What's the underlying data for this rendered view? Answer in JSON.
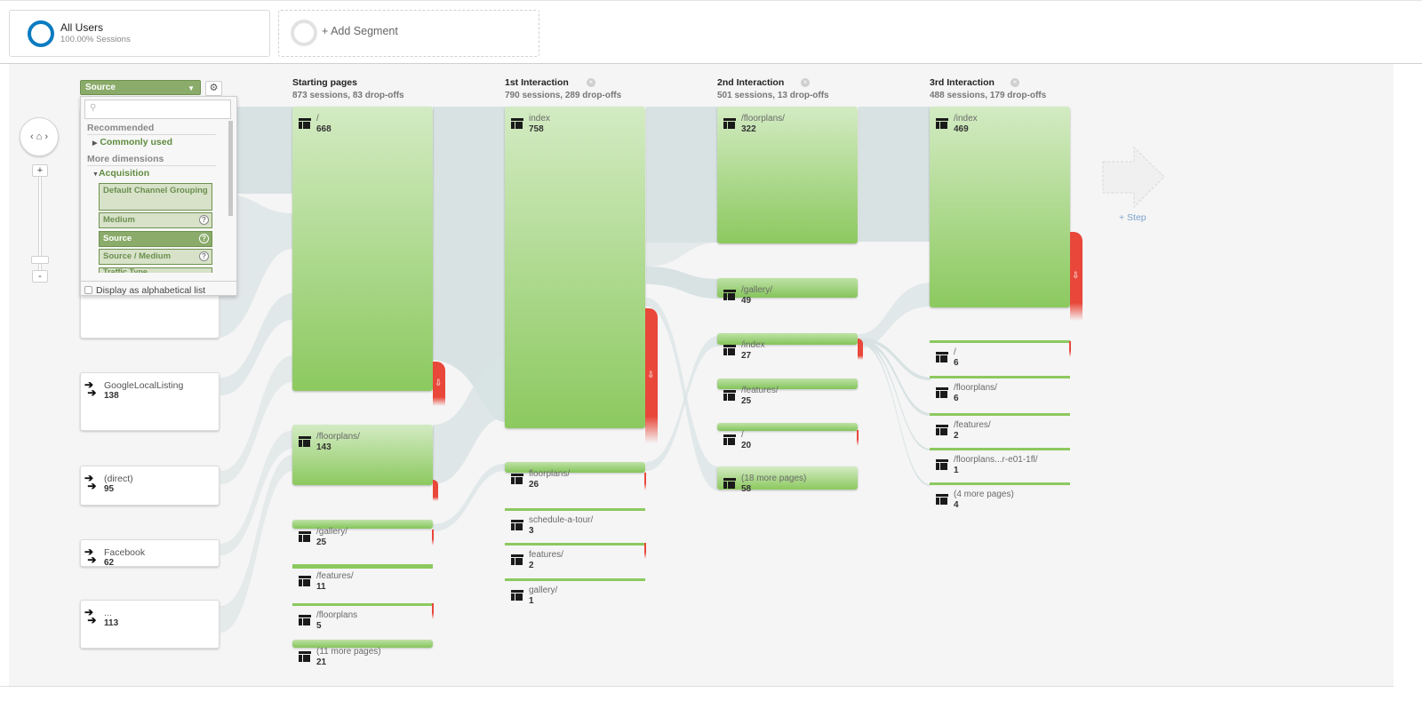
{
  "segments": [
    {
      "name": "All Users",
      "detail": "100.00% Sessions",
      "color": "#0a7bc1"
    },
    {
      "name": "+ Add Segment"
    }
  ],
  "dimension_selector": {
    "selected": "Source",
    "search_placeholder": "",
    "recommended_header": "Recommended",
    "commonly_used": "Commonly used",
    "more_header": "More dimensions",
    "acquisition": "Acquisition",
    "options": [
      "Default Channel Grouping",
      "Medium",
      "Source",
      "Source / Medium",
      "Traffic Type"
    ],
    "alphabetical_label": "Display as alphabetical list"
  },
  "sources": [
    {
      "label": "GoogleLocalListing",
      "count": "138"
    },
    {
      "label": "(direct)",
      "count": "95"
    },
    {
      "label": "Facebook",
      "count": "62"
    },
    {
      "label": "...",
      "count": "113"
    }
  ],
  "columns": [
    {
      "title": "Starting pages",
      "summary": "873 sessions, 83 drop-offs",
      "closable": false,
      "nodes": [
        {
          "label": "/",
          "count": "668"
        },
        {
          "label": "/floorplans/",
          "count": "143"
        },
        {
          "label": "/gallery/",
          "count": "25"
        },
        {
          "label": "/features/",
          "count": "11"
        },
        {
          "label": "/floorplans",
          "count": "5"
        },
        {
          "label": "(11 more pages)",
          "count": "21"
        }
      ]
    },
    {
      "title": "1st Interaction",
      "summary": "790 sessions, 289 drop-offs",
      "closable": true,
      "nodes": [
        {
          "label": "index",
          "count": "758"
        },
        {
          "label": "floorplans/",
          "count": "26"
        },
        {
          "label": "schedule-a-tour/",
          "count": "3"
        },
        {
          "label": "features/",
          "count": "2"
        },
        {
          "label": "gallery/",
          "count": "1"
        }
      ]
    },
    {
      "title": "2nd Interaction",
      "summary": "501 sessions, 13 drop-offs",
      "closable": true,
      "nodes": [
        {
          "label": "/floorplans/",
          "count": "322"
        },
        {
          "label": "/gallery/",
          "count": "49"
        },
        {
          "label": "/index",
          "count": "27"
        },
        {
          "label": "/features/",
          "count": "25"
        },
        {
          "label": "/",
          "count": "20"
        },
        {
          "label": "(18 more pages)",
          "count": "58"
        }
      ]
    },
    {
      "title": "3rd Interaction",
      "summary": "488 sessions, 179 drop-offs",
      "closable": true,
      "nodes": [
        {
          "label": "/index",
          "count": "469"
        },
        {
          "label": "/",
          "count": "6"
        },
        {
          "label": "/floorplans/",
          "count": "6"
        },
        {
          "label": "/features/",
          "count": "2"
        },
        {
          "label": "/floorplans...r-e01-1fl/",
          "count": "1"
        },
        {
          "label": "(4 more pages)",
          "count": "4"
        }
      ]
    }
  ],
  "add_step_label": "+ Step",
  "colors": {
    "node_green": "#8cc95f",
    "dropoff_red": "#e8473a",
    "flow_gray": "#d3dee0"
  }
}
